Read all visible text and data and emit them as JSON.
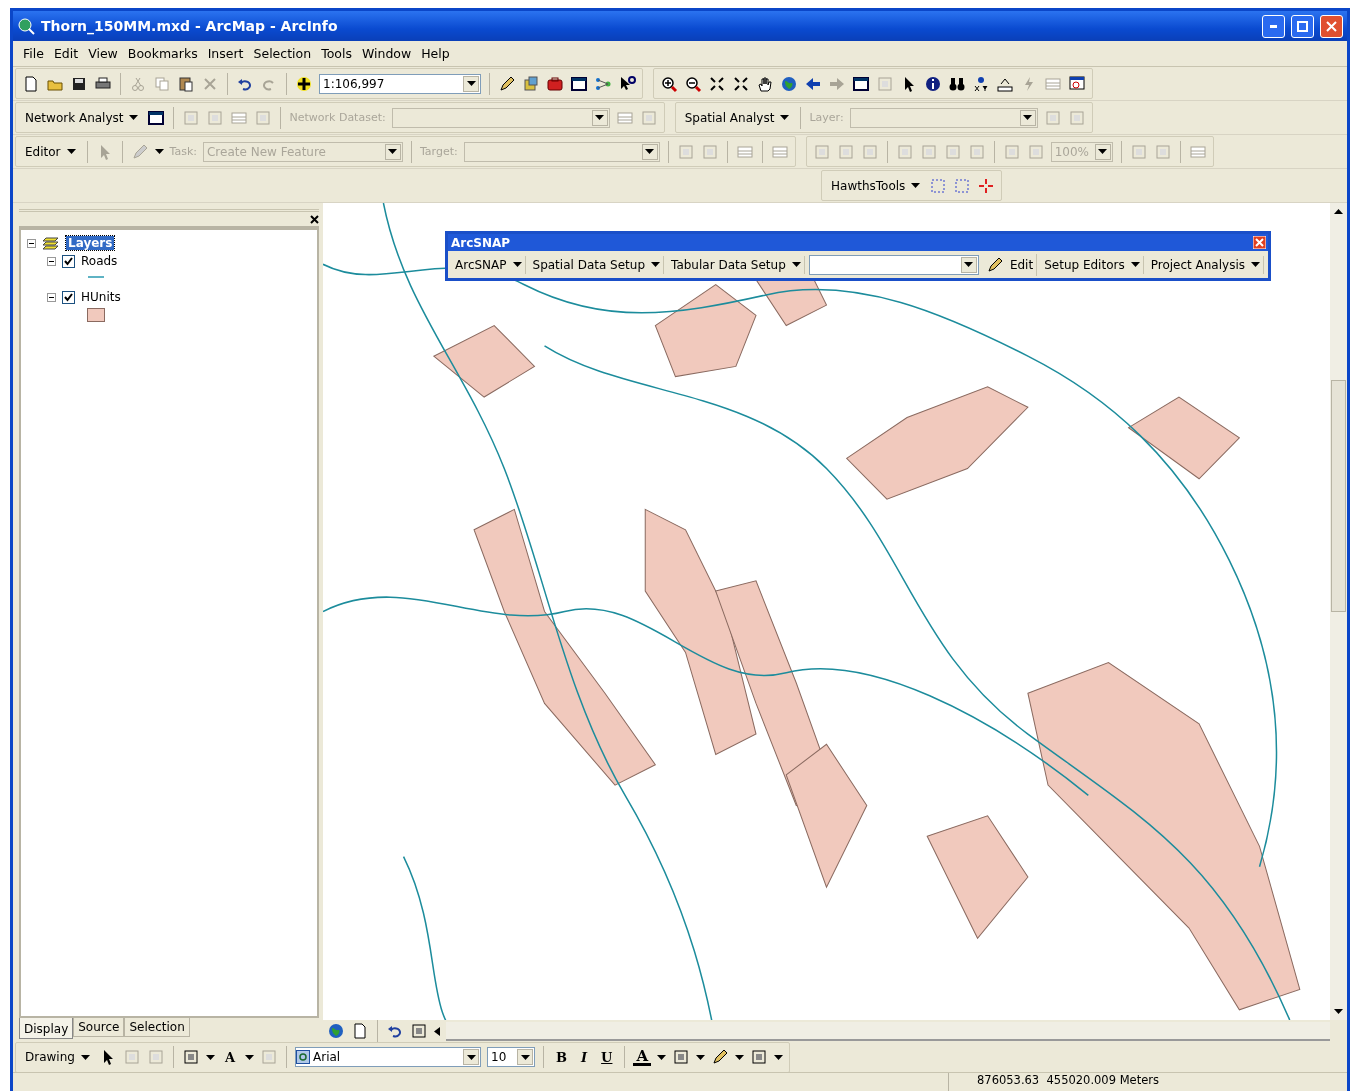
{
  "window": {
    "title": "Thorn_150MM.mxd - ArcMap - ArcInfo"
  },
  "menu": [
    "File",
    "Edit",
    "View",
    "Bookmarks",
    "Insert",
    "Selection",
    "Tools",
    "Window",
    "Help"
  ],
  "standard_toolbar": {
    "scale": "1:106,997"
  },
  "network_analyst_toolbar": {
    "menu": "Network Analyst",
    "dataset": {
      "label": "Network Dataset:",
      "disabled": true
    }
  },
  "spatial_analyst_toolbar": {
    "menu": "Spatial Analyst",
    "layer": {
      "label": "Layer:",
      "disabled": true
    }
  },
  "editor_toolbar": {
    "menu": "Editor",
    "task": {
      "label": "Task:",
      "value": "Create New Feature",
      "disabled": true
    },
    "target": {
      "label": "Target:",
      "disabled": true
    }
  },
  "layout_toolbar": {
    "zoom": {
      "value": "100%",
      "disabled": true
    }
  },
  "hawths_toolbar": {
    "menu": "HawthsTools"
  },
  "toc": {
    "root": {
      "label": "Layers",
      "selected": true,
      "expanded": true,
      "children": [
        {
          "label": "Roads",
          "checked": true,
          "expanded": true,
          "kind": "line"
        },
        {
          "label": "HUnits",
          "checked": true,
          "expanded": true,
          "kind": "fill"
        }
      ]
    },
    "tabs": [
      {
        "label": "Display",
        "selected": true
      },
      {
        "label": "Source",
        "selected": false
      },
      {
        "label": "Selection",
        "selected": false
      }
    ]
  },
  "arcsnap": {
    "title": "ArcSNAP",
    "items": [
      {
        "kind": "menu",
        "label": "ArcSNAP"
      },
      {
        "kind": "menu",
        "label": "Spatial Data Setup"
      },
      {
        "kind": "menu",
        "label": "Tabular Data Setup"
      },
      {
        "kind": "combo"
      },
      {
        "kind": "button",
        "label": "Edit"
      },
      {
        "kind": "menu",
        "label": "Setup Editors"
      },
      {
        "kind": "menu",
        "label": "Project Analysis"
      }
    ]
  },
  "drawing_toolbar": {
    "menu": "Drawing",
    "text_tool": "A",
    "font": "Arial",
    "size": "10",
    "bold": "B",
    "italic": "I",
    "underline": "U",
    "font_color": "A"
  },
  "status_bar": {
    "coordinates": "876053.63  455020.009 Meters"
  }
}
